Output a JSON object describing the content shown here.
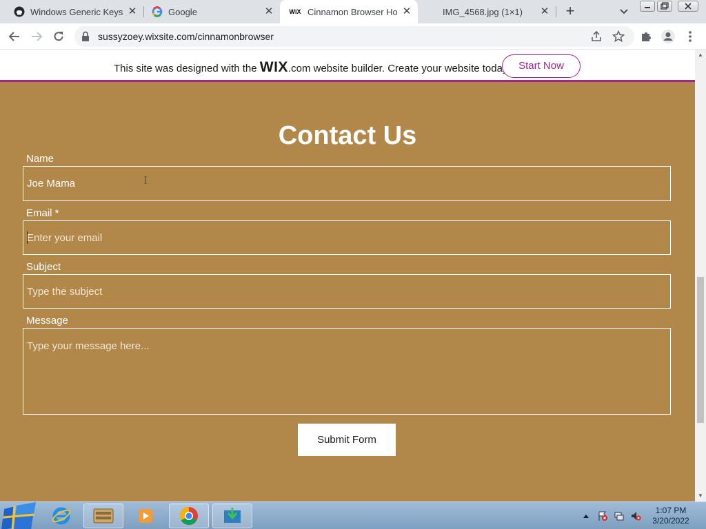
{
  "browser": {
    "tabs": [
      {
        "title": "Windows Generic Keys - G",
        "icon": "github-icon",
        "active": false
      },
      {
        "title": "Google",
        "icon": "google-icon",
        "active": false
      },
      {
        "title": "Cinnamon Browser Home",
        "icon": "wix-icon",
        "active": true
      },
      {
        "title": "IMG_4568.jpg (1×1)",
        "icon": "blank-icon",
        "active": false
      }
    ],
    "url": "sussyzoey.wixsite.com/cinnamonbrowser"
  },
  "wix_banner": {
    "message_before": "This site was designed with the ",
    "brand": "WIX",
    "message_after": ".com website builder. Create your website today.",
    "cta": "Start Now"
  },
  "contact": {
    "heading": "Contact Us",
    "fields": {
      "name": {
        "label": "Name",
        "value": "Joe Mama"
      },
      "email": {
        "label": "Email *",
        "placeholder": "Enter your email"
      },
      "subject": {
        "label": "Subject",
        "placeholder": "Type the subject"
      },
      "message": {
        "label": "Message",
        "placeholder": "Type your message here..."
      }
    },
    "submit": "Submit Form"
  },
  "colors": {
    "page_background": "#b2884a",
    "wix_accent": "#a0258e"
  },
  "taskbar": {
    "apps": [
      "internet-explorer-icon",
      "file-explorer-icon",
      "media-player-icon",
      "chrome-icon",
      "download-app-icon"
    ],
    "time": "1:07 PM",
    "date": "3/20/2022"
  }
}
